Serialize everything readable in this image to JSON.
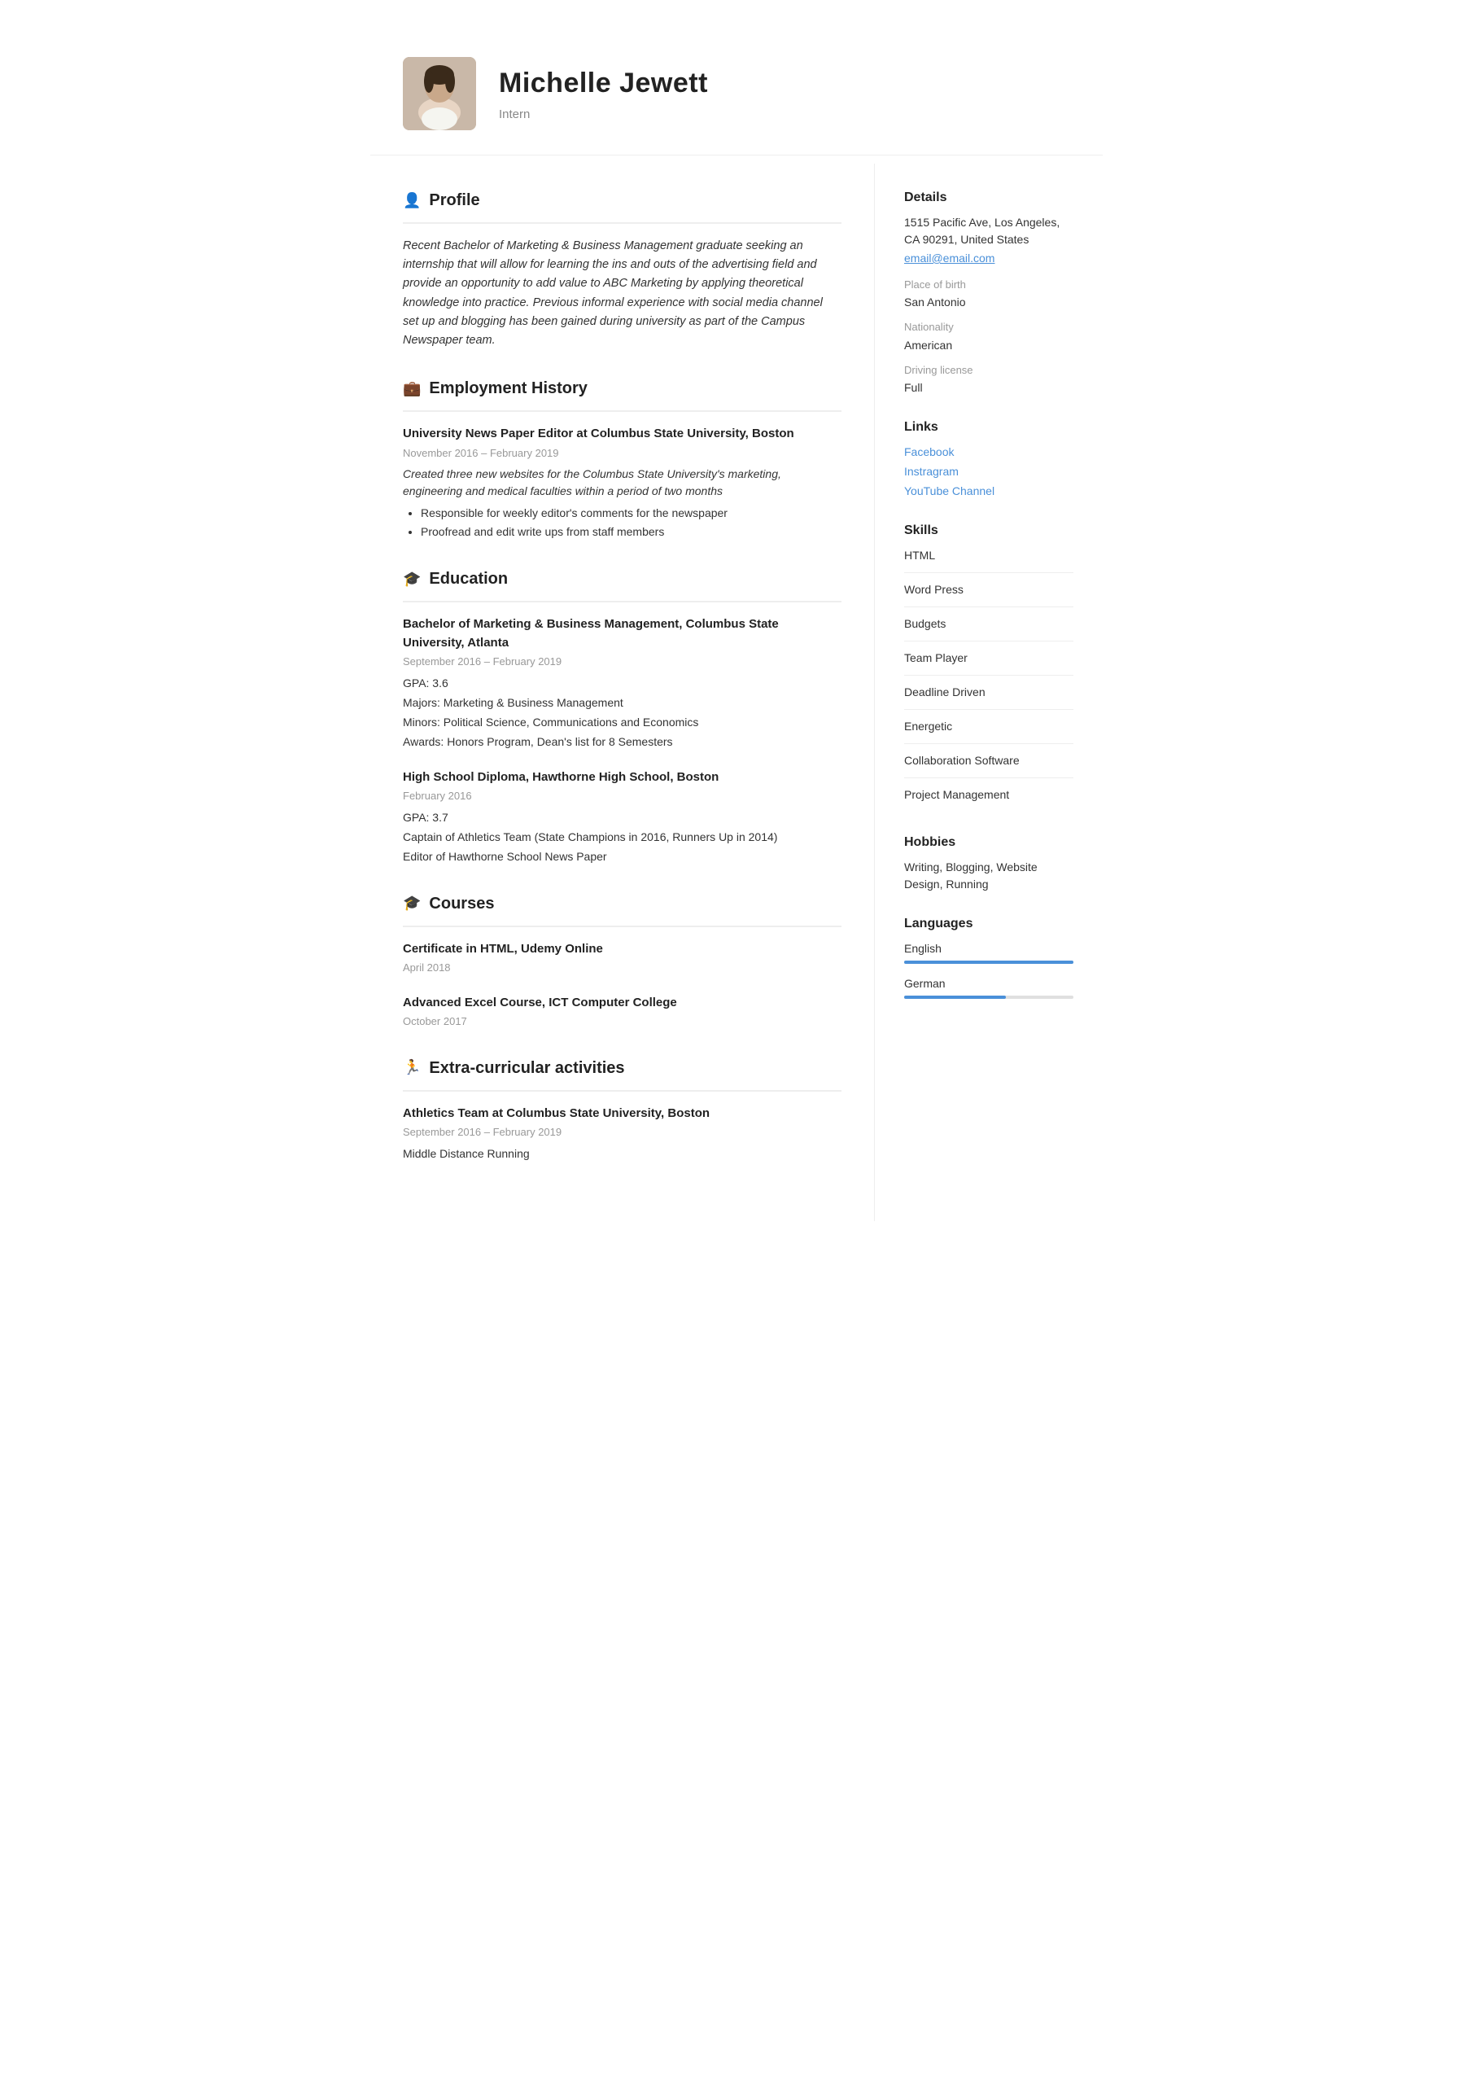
{
  "header": {
    "name": "Michelle Jewett",
    "title": "Intern"
  },
  "profile": {
    "section_title": "Profile",
    "icon": "👤",
    "text": "Recent Bachelor of Marketing & Business Management graduate seeking an internship that will allow for learning the ins and outs of the advertising field and provide an opportunity to add value to ABC Marketing by applying theoretical knowledge into practice. Previous informal experience with social media channel set up and blogging has been gained during university as part of the Campus Newspaper team."
  },
  "employment": {
    "section_title": "Employment History",
    "icon": "💼",
    "entries": [
      {
        "title": "University News Paper Editor at Columbus State University, Boston",
        "date": "November 2016 – February 2019",
        "desc": "Created three new websites for the Columbus State University's marketing, engineering and medical faculties within a period of two months",
        "bullets": [
          "Responsible for weekly editor's comments for the newspaper",
          "Proofread and edit write ups from staff members"
        ]
      }
    ]
  },
  "education": {
    "section_title": "Education",
    "icon": "🎓",
    "entries": [
      {
        "title": "Bachelor of Marketing & Business Management, Columbus State University, Atlanta",
        "date": "September 2016 – February 2019",
        "details": [
          "GPA: 3.6",
          "Majors: Marketing & Business Management",
          "Minors: Political Science, Communications and Economics",
          "Awards: Honors Program, Dean's list for 8 Semesters"
        ]
      },
      {
        "title": "High School Diploma, Hawthorne High School, Boston",
        "date": "February 2016",
        "details": [
          "GPA: 3.7",
          "Captain of Athletics Team (State Champions in 2016, Runners Up in 2014)",
          "Editor of Hawthorne School News Paper"
        ]
      }
    ]
  },
  "courses": {
    "section_title": "Courses",
    "icon": "🎓",
    "entries": [
      {
        "title": "Certificate in HTML, Udemy Online",
        "date": "April 2018"
      },
      {
        "title": "Advanced Excel Course, ICT Computer College",
        "date": "October 2017"
      }
    ]
  },
  "extracurricular": {
    "section_title": "Extra-curricular activities",
    "icon": "🏃",
    "entries": [
      {
        "title": "Athletics Team at Columbus State University, Boston",
        "date": "September 2016 – February 2019",
        "details": [
          "Middle Distance Running"
        ]
      }
    ]
  },
  "details": {
    "section_title": "Details",
    "address": "1515 Pacific Ave, Los Angeles, CA 90291, United States",
    "email": "email@email.com",
    "place_of_birth_label": "Place of birth",
    "place_of_birth": "San Antonio",
    "nationality_label": "Nationality",
    "nationality": "American",
    "driving_license_label": "Driving license",
    "driving_license": "Full"
  },
  "links": {
    "section_title": "Links",
    "items": [
      {
        "label": "Facebook",
        "url": "#"
      },
      {
        "label": "Instragram",
        "url": "#"
      },
      {
        "label": "YouTube Channel",
        "url": "#"
      }
    ]
  },
  "skills": {
    "section_title": "Skills",
    "items": [
      "HTML",
      "Word Press",
      "Budgets",
      "Team Player",
      "Deadline Driven",
      "Energetic",
      "Collaboration Software",
      "Project Management"
    ]
  },
  "hobbies": {
    "section_title": "Hobbies",
    "text": "Writing, Blogging, Website Design, Running"
  },
  "languages": {
    "section_title": "Languages",
    "items": [
      {
        "name": "English",
        "level": 100
      },
      {
        "name": "German",
        "level": 60
      }
    ]
  }
}
